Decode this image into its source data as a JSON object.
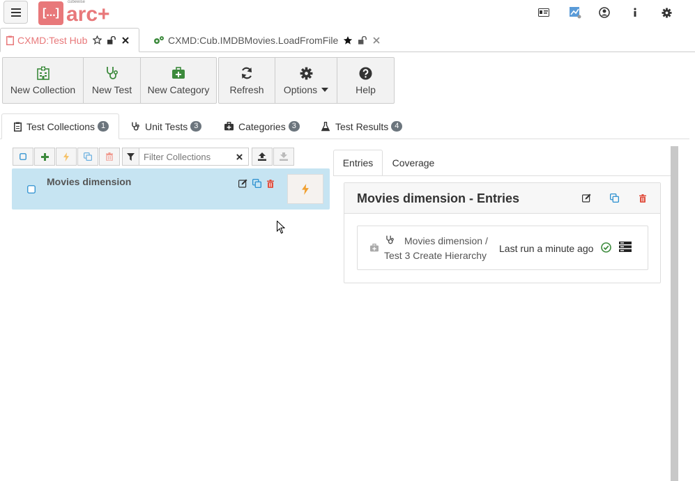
{
  "header": {
    "logo_small": "cubewise",
    "logo_box": "[...]",
    "logo_text": "arc+",
    "icons": [
      "id-card-icon",
      "chart-icon",
      "user-icon",
      "info-icon",
      "gear-icon"
    ]
  },
  "doc_tabs": [
    {
      "label": "CXMD:Test Hub",
      "icon": "clipboard-icon",
      "active": true,
      "color": "#e8787a"
    },
    {
      "label": "CXMD:Cub.IMDBMovies.LoadFromFile",
      "icon": "cogs-icon",
      "active": false,
      "color": "#555555"
    }
  ],
  "toolbar": {
    "new_collection": "New Collection",
    "new_test": "New Test",
    "new_category": "New Category",
    "refresh": "Refresh",
    "options": "Options",
    "help": "Help"
  },
  "sub_tabs": {
    "collections": {
      "label": "Test Collections",
      "count": "1"
    },
    "unit_tests": {
      "label": "Unit Tests",
      "count": "3"
    },
    "categories": {
      "label": "Categories",
      "count": "3"
    },
    "results": {
      "label": "Test Results",
      "count": "4"
    }
  },
  "filter": {
    "placeholder": "Filter Collections"
  },
  "collection": {
    "name": "Movies dimension"
  },
  "right_tabs": {
    "entries": "Entries",
    "coverage": "Coverage"
  },
  "entries": {
    "title": "Movies dimension - Entries",
    "row": {
      "path": "Movies dimension /",
      "test": "Test 3 Create Hierarchy",
      "status": "Last run a minute ago"
    }
  },
  "colors": {
    "accent": "#e8787a",
    "green": "#3c8a3c",
    "selected_bg": "#c6e4f2",
    "orange": "#f0a030",
    "red": "#e05040",
    "blue": "#2a8fcf"
  }
}
